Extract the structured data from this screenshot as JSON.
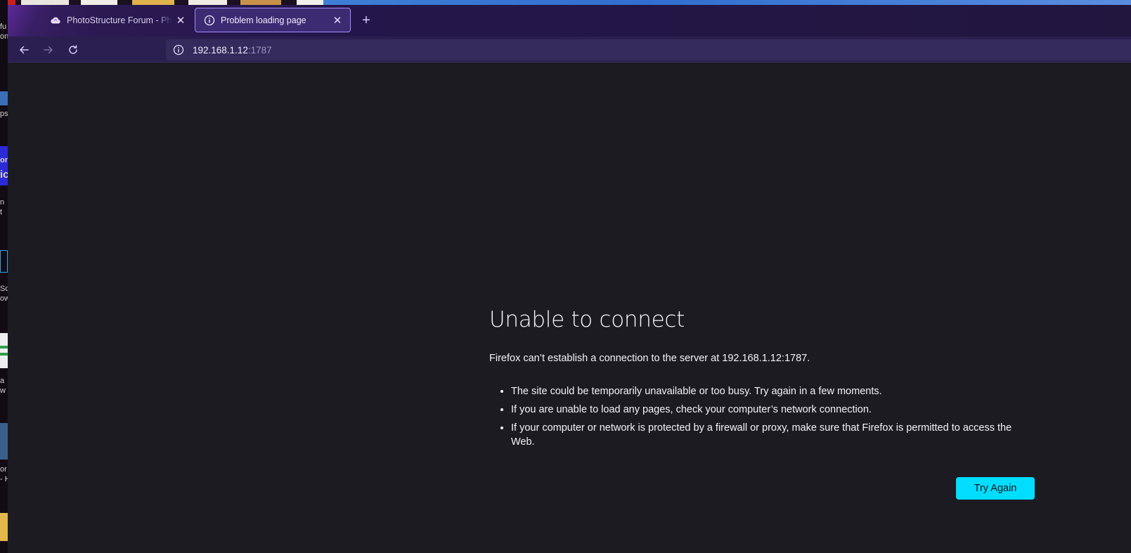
{
  "desktop": {
    "fragments": [
      "fu",
      "on",
      "ps",
      "on",
      "ic",
      "n",
      "t",
      "Sc",
      "ow",
      "a",
      "w",
      "or",
      "- H"
    ]
  },
  "tabs": [
    {
      "title": "PhotoStructure Forum - PhotoStructure",
      "active": false,
      "icon": "cloud-icon"
    },
    {
      "title": "Problem loading page",
      "active": true,
      "icon": "info-icon"
    }
  ],
  "urlbar": {
    "host": "192.168.1.12",
    "port": ":1787"
  },
  "error": {
    "title": "Unable to connect",
    "description": "Firefox can’t establish a connection to the server at 192.168.1.12:1787.",
    "items": [
      "The site could be temporarily unavailable or too busy. Try again in a few moments.",
      "If you are unable to load any pages, check your computer’s network connection.",
      "If your computer or network is protected by a firewall or proxy, make sure that Firefox is permitted to access the Web."
    ],
    "button_label": "Try Again"
  },
  "colors": {
    "accent": "#00ddff",
    "page_bg": "#1c1b22",
    "tab_active_border": "#a98cff"
  }
}
